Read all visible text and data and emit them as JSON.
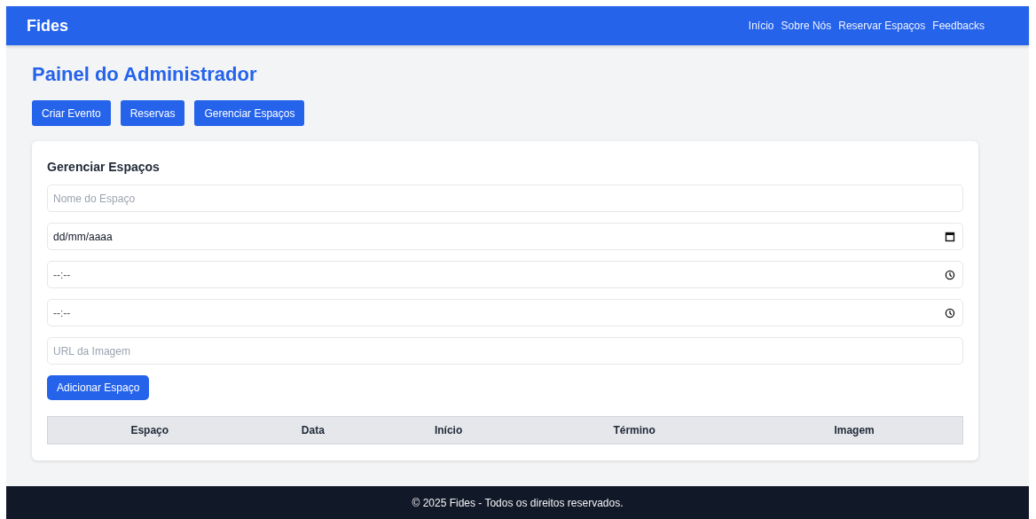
{
  "header": {
    "brand": "Fides",
    "nav": [
      "Início",
      "Sobre Nós",
      "Reservar Espaços",
      "Feedbacks"
    ]
  },
  "page_title": "Painel do Administrador",
  "actions": [
    "Criar Evento",
    "Reservas",
    "Gerenciar Espaços"
  ],
  "form": {
    "title": "Gerenciar Espaços",
    "fields": [
      {
        "kind": "text",
        "placeholder": "Nome do Espaço"
      },
      {
        "kind": "date",
        "value": "dd/mm/aaaa"
      },
      {
        "kind": "time",
        "value": "--:--"
      },
      {
        "kind": "time",
        "value": "--:--"
      },
      {
        "kind": "text",
        "placeholder": "URL da Imagem"
      }
    ],
    "submit": "Adicionar Espaço"
  },
  "table": {
    "columns": [
      "Espaço",
      "Data",
      "Início",
      "Término",
      "Imagem"
    ]
  },
  "footer": "© 2025 Fides - Todos os direitos reservados."
}
